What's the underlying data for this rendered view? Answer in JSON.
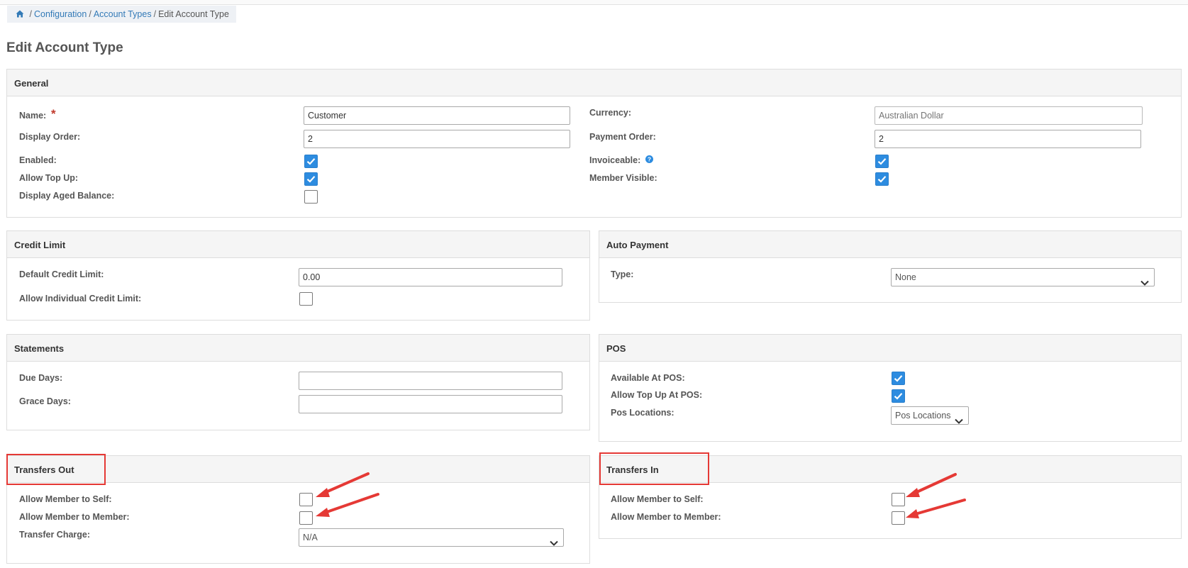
{
  "breadcrumb": {
    "home_icon": "home-icon",
    "sep": "/",
    "items": [
      "Configuration",
      "Account Types",
      "Edit Account Type"
    ]
  },
  "page_title": "Edit Account Type",
  "general": {
    "title": "General",
    "name_label": "Name:",
    "name_required_mark": "*",
    "name_value": "Customer",
    "display_order_label": "Display Order:",
    "display_order_value": "2",
    "enabled_label": "Enabled:",
    "enabled_checked": true,
    "allow_top_up_label": "Allow Top Up:",
    "allow_top_up_checked": true,
    "display_aged_balance_label": "Display Aged Balance:",
    "display_aged_balance_checked": false,
    "currency_label": "Currency:",
    "currency_placeholder": "Australian Dollar",
    "payment_order_label": "Payment Order:",
    "payment_order_value": "2",
    "invoiceable_label": "Invoiceable:",
    "invoiceable_checked": true,
    "member_visible_label": "Member Visible:",
    "member_visible_checked": true
  },
  "credit_limit": {
    "title": "Credit Limit",
    "default_credit_limit_label": "Default Credit Limit:",
    "default_credit_limit_value": "0.00",
    "allow_individual_label": "Allow Individual Credit Limit:",
    "allow_individual_checked": false
  },
  "auto_payment": {
    "title": "Auto Payment",
    "type_label": "Type:",
    "type_value": "None"
  },
  "statements": {
    "title": "Statements",
    "due_days_label": "Due Days:",
    "due_days_value": "",
    "grace_days_label": "Grace Days:",
    "grace_days_value": ""
  },
  "pos": {
    "title": "POS",
    "available_label": "Available At POS:",
    "available_checked": true,
    "allow_top_up_label": "Allow Top Up At POS:",
    "allow_top_up_checked": true,
    "locations_label": "Pos Locations:",
    "locations_value": "Pos Locations"
  },
  "transfers_out": {
    "title": "Transfers Out",
    "member_to_self_label": "Allow Member to Self:",
    "member_to_self_checked": false,
    "member_to_member_label": "Allow Member to Member:",
    "member_to_member_checked": false,
    "transfer_charge_label": "Transfer Charge:",
    "transfer_charge_value": "N/A"
  },
  "transfers_in": {
    "title": "Transfers In",
    "member_to_self_label": "Allow Member to Self:",
    "member_to_self_checked": false,
    "member_to_member_label": "Allow Member to Member:",
    "member_to_member_checked": false
  },
  "colors": {
    "accent": "#2d8ce0",
    "link": "#337ab7",
    "annotation": "#e53935"
  }
}
